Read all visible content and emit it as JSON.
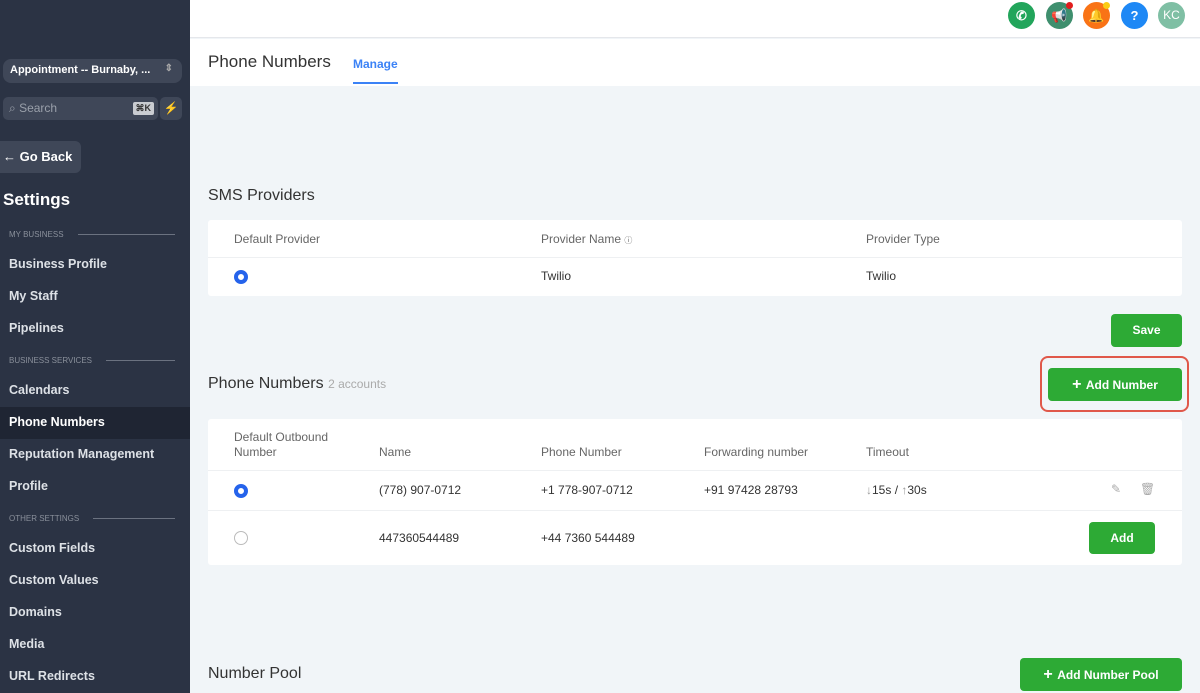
{
  "sidebar": {
    "location": "Appointment -- Burnaby, ...",
    "search_placeholder": "Search",
    "shortcut": "⌘K",
    "go_back": "Go Back",
    "title": "Settings",
    "sections": [
      {
        "label": "MY BUSINESS"
      },
      {
        "label": "BUSINESS SERVICES"
      },
      {
        "label": "OTHER SETTINGS"
      }
    ],
    "items": [
      {
        "label": "Business Profile"
      },
      {
        "label": "My Staff"
      },
      {
        "label": "Pipelines"
      },
      {
        "label": "Calendars"
      },
      {
        "label": "Phone Numbers"
      },
      {
        "label": "Reputation Management"
      },
      {
        "label": "Profile"
      },
      {
        "label": "Custom Fields"
      },
      {
        "label": "Custom Values"
      },
      {
        "label": "Domains"
      },
      {
        "label": "Media"
      },
      {
        "label": "URL Redirects"
      }
    ]
  },
  "topbar": {
    "avatar": "KC"
  },
  "header": {
    "title": "Phone Numbers",
    "tab": "Manage"
  },
  "sms": {
    "title": "SMS Providers",
    "columns": [
      "Default Provider",
      "Provider Name",
      "Provider Type"
    ],
    "row": {
      "name": "Twilio",
      "type": "Twilio"
    },
    "save": "Save"
  },
  "numbers": {
    "title": "Phone Numbers",
    "count": "2 accounts",
    "add": "Add Number",
    "columns": [
      "Default Outbound Number",
      "Name",
      "Phone Number",
      "Forwarding number",
      "Timeout"
    ],
    "rows": [
      {
        "name": "(778) 907-0712",
        "phone": "+1 778-907-0712",
        "forward": "+91 97428 28793",
        "timeout_in": "15s",
        "timeout_out": "30s"
      },
      {
        "name": "447360544489",
        "phone": "+44 7360 544489",
        "action": "Add"
      }
    ]
  },
  "pool": {
    "title": "Number Pool",
    "add": "Add Number Pool"
  }
}
